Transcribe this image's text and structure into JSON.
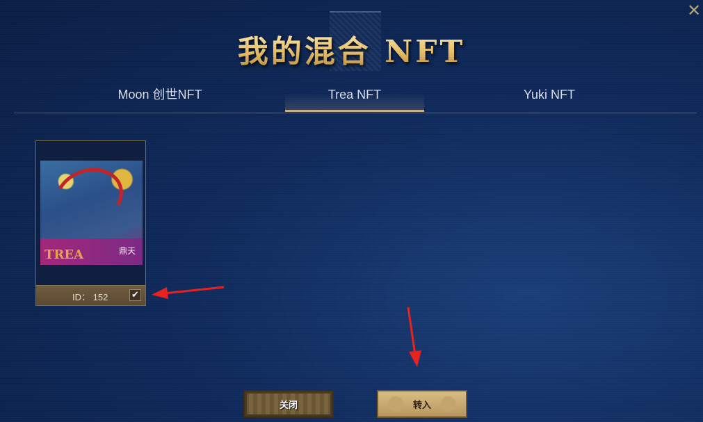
{
  "dialog": {
    "title": "我的混合 NFT",
    "close_glyph": "✕"
  },
  "tabs": [
    {
      "label": "Moon 创世NFT",
      "active": false
    },
    {
      "label": "Trea NFT",
      "active": true
    },
    {
      "label": "Yuki NFT",
      "active": false
    }
  ],
  "cards": [
    {
      "id_label": "ID： 152",
      "art_caption": "TREA",
      "art_glyph": "鼎天",
      "selected": true,
      "check_glyph": "✔"
    }
  ],
  "buttons": {
    "close_label": "关闭",
    "transfer_label": "转入"
  },
  "colors": {
    "accent_gold": "#c9b08a",
    "annotation_red": "#e8231f",
    "background": "#0f2a5c"
  }
}
